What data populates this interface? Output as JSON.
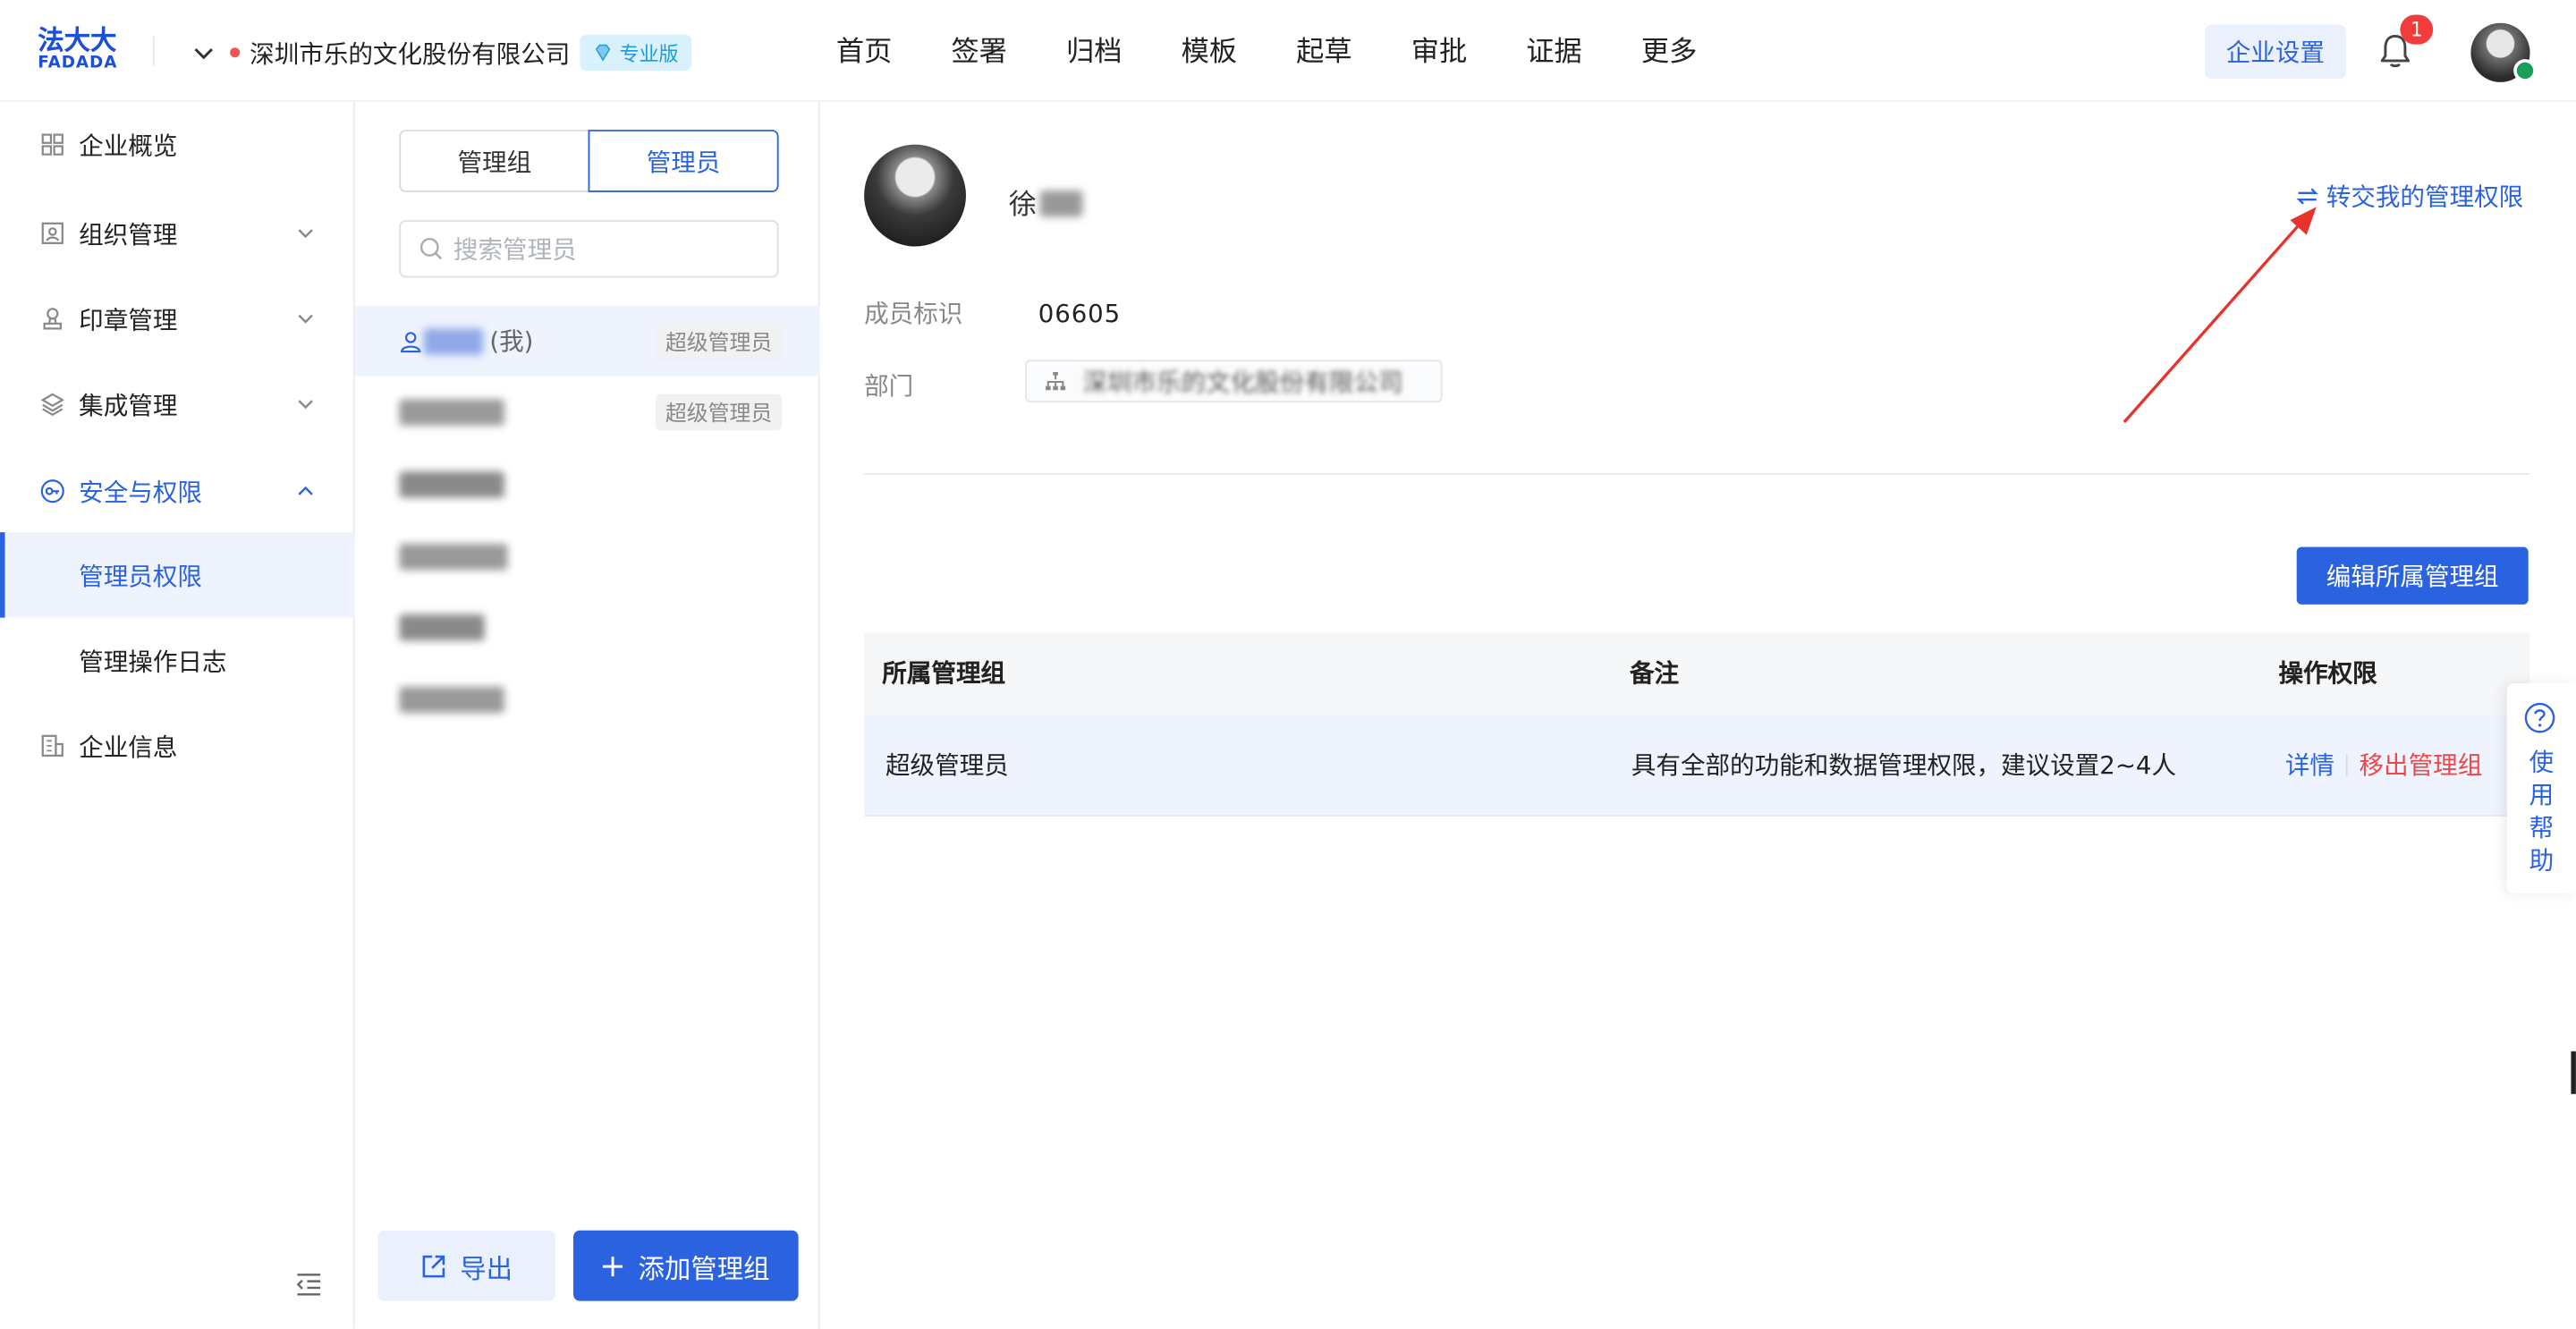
{
  "app": {
    "logo_zh": "法大大",
    "logo_en": "FADADA",
    "company_name": "深圳市乐的文化股份有限公司",
    "edition_badge": "专业版"
  },
  "topnav": {
    "items": [
      "首页",
      "签署",
      "归档",
      "模板",
      "起草",
      "审批",
      "证据",
      "更多"
    ],
    "enterprise_settings": "企业设置",
    "notification_count": "1"
  },
  "sidebar": {
    "items": [
      {
        "label": "企业概览",
        "icon": "dashboard-icon"
      },
      {
        "label": "组织管理",
        "icon": "org-icon",
        "expandable": true
      },
      {
        "label": "印章管理",
        "icon": "seal-icon",
        "expandable": true
      },
      {
        "label": "集成管理",
        "icon": "layers-icon",
        "expandable": true
      },
      {
        "label": "安全与权限",
        "icon": "key-icon",
        "expandable": true,
        "expanded": true
      },
      {
        "label": "企业信息",
        "icon": "building-icon"
      }
    ],
    "sub_items": [
      {
        "label": "管理员权限",
        "selected": true
      },
      {
        "label": "管理操作日志"
      }
    ]
  },
  "middle": {
    "tabs": [
      "管理组",
      "管理员"
    ],
    "active_tab": "管理员",
    "search_placeholder": "搜索管理员",
    "members": [
      {
        "name_suffix": "(我)",
        "tag": "超级管理员",
        "selected": true
      },
      {
        "name_suffix": "",
        "tag": "超级管理员"
      },
      {
        "name_suffix": "",
        "tag": ""
      },
      {
        "name_suffix": "",
        "tag": ""
      },
      {
        "name_suffix": "",
        "tag": ""
      },
      {
        "name_suffix": "",
        "tag": ""
      }
    ],
    "export_label": "导出",
    "add_group_label": "添加管理组"
  },
  "profile": {
    "name": "徐",
    "transfer_label": "转交我的管理权限",
    "member_id_label": "成员标识",
    "member_id_value": "06605",
    "department_label": "部门",
    "department_value": "深圳市乐的文化股份有限公司",
    "edit_groups_label": "编辑所属管理组"
  },
  "table": {
    "headers": [
      "所属管理组",
      "备注",
      "操作权限"
    ],
    "rows": [
      {
        "group": "超级管理员",
        "remark": "具有全部的功能和数据管理权限，建议设置2~4人",
        "action_detail": "详情",
        "action_remove": "移出管理组"
      }
    ]
  },
  "help": {
    "label": "使用帮助"
  },
  "colors": {
    "primary": "#2a62e0",
    "danger": "#ef4747",
    "annotation_arrow": "#e8322b"
  }
}
